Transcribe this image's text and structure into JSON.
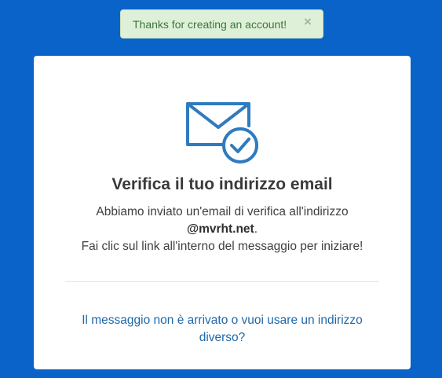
{
  "toast": {
    "message": "Thanks for creating an account!",
    "close_symbol": "×",
    "close_icon": "close-icon",
    "background_color": "#dff0d8",
    "text_color": "#3c763d"
  },
  "card": {
    "icon": "envelope-check-icon",
    "icon_color": "#2f7bbf",
    "title": "Verifica il tuo indirizzo email",
    "message_line1": "Abbiamo inviato un'email di verifica all'indirizzo",
    "email": "@mvrht.net",
    "email_suffix": ".",
    "message_line3": "Fai clic sul link all'interno del messaggio per iniziare!",
    "resend_link": "Il messaggio non è arrivato o vuoi usare un indirizzo diverso?",
    "link_color": "#1f68a9"
  },
  "page": {
    "background_color": "#0a63c9"
  }
}
